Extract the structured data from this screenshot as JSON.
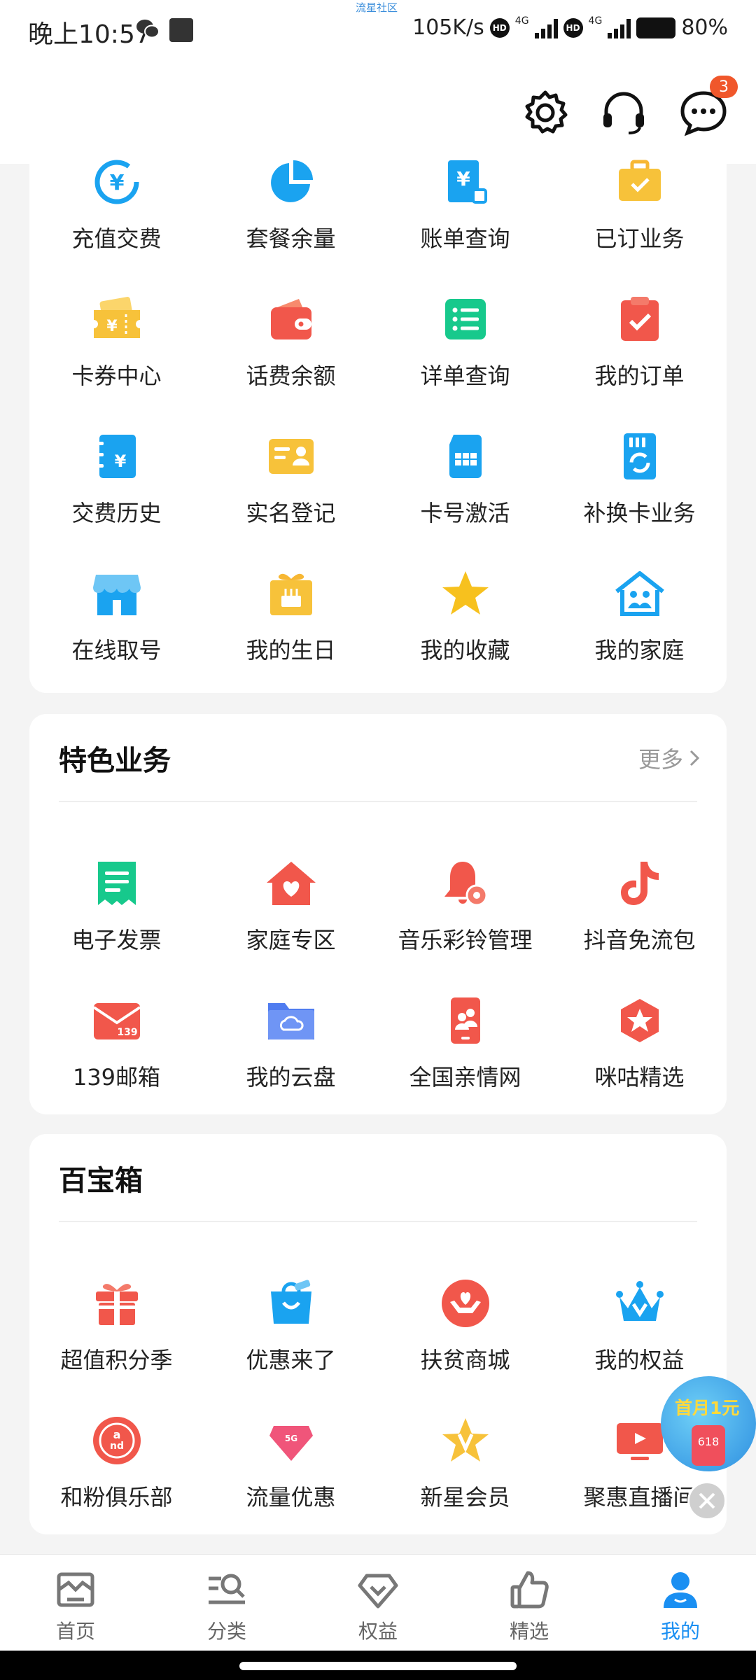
{
  "status": {
    "time": "晚上10:57",
    "speed": "105K/s",
    "net1": "4G",
    "net2": "4G",
    "hd": "HD",
    "battery": "80%",
    "tiny_label": "流星社区"
  },
  "topbar": {
    "message_badge": "3"
  },
  "colors": {
    "accent": "#1a8ff2",
    "badge": "#f0572b"
  },
  "services": {
    "items": [
      {
        "label": "充值交费",
        "icon": "recharge-icon"
      },
      {
        "label": "套餐余量",
        "icon": "pie-chart-icon"
      },
      {
        "label": "账单查询",
        "icon": "bill-icon"
      },
      {
        "label": "已订业务",
        "icon": "briefcase-icon"
      },
      {
        "label": "卡券中心",
        "icon": "coupon-icon"
      },
      {
        "label": "话费余额",
        "icon": "wallet-icon"
      },
      {
        "label": "详单查询",
        "icon": "list-icon"
      },
      {
        "label": "我的订单",
        "icon": "clipboard-check-icon"
      },
      {
        "label": "交费历史",
        "icon": "notebook-icon"
      },
      {
        "label": "实名登记",
        "icon": "id-card-icon"
      },
      {
        "label": "卡号激活",
        "icon": "sim-card-icon"
      },
      {
        "label": "补换卡业务",
        "icon": "sim-swap-icon"
      },
      {
        "label": "在线取号",
        "icon": "store-icon"
      },
      {
        "label": "我的生日",
        "icon": "birthday-gift-icon"
      },
      {
        "label": "我的收藏",
        "icon": "star-icon"
      },
      {
        "label": "我的家庭",
        "icon": "family-home-icon"
      }
    ]
  },
  "featured": {
    "title": "特色业务",
    "more": "更多",
    "items": [
      {
        "label": "电子发票",
        "icon": "invoice-icon"
      },
      {
        "label": "家庭专区",
        "icon": "heart-house-icon"
      },
      {
        "label": "音乐彩铃管理",
        "icon": "bell-gear-icon"
      },
      {
        "label": "抖音免流包",
        "icon": "tiktok-icon"
      },
      {
        "label": "139邮箱",
        "icon": "mail-139-icon"
      },
      {
        "label": "我的云盘",
        "icon": "cloud-folder-icon"
      },
      {
        "label": "全国亲情网",
        "icon": "family-phone-icon"
      },
      {
        "label": "咪咕精选",
        "icon": "migu-star-icon"
      }
    ]
  },
  "treasure": {
    "title": "百宝箱",
    "items": [
      {
        "label": "超值积分季",
        "icon": "gift-box-icon"
      },
      {
        "label": "优惠来了",
        "icon": "shopping-bag-icon"
      },
      {
        "label": "扶贫商城",
        "icon": "hands-heart-icon"
      },
      {
        "label": "我的权益",
        "icon": "crown-icon"
      },
      {
        "label": "和粉俱乐部",
        "icon": "and-club-icon"
      },
      {
        "label": "流量优惠",
        "icon": "data-gem-icon"
      },
      {
        "label": "新星会员",
        "icon": "v-star-icon"
      },
      {
        "label": "聚惠直播间",
        "icon": "live-tv-icon"
      }
    ]
  },
  "float_ad": {
    "title": "首月1元",
    "sub": "618"
  },
  "tabs": [
    {
      "label": "首页",
      "icon": "home-icon"
    },
    {
      "label": "分类",
      "icon": "category-search-icon"
    },
    {
      "label": "权益",
      "icon": "diamond-icon"
    },
    {
      "label": "精选",
      "icon": "thumbs-up-icon"
    },
    {
      "label": "我的",
      "icon": "user-icon",
      "active": true
    }
  ]
}
